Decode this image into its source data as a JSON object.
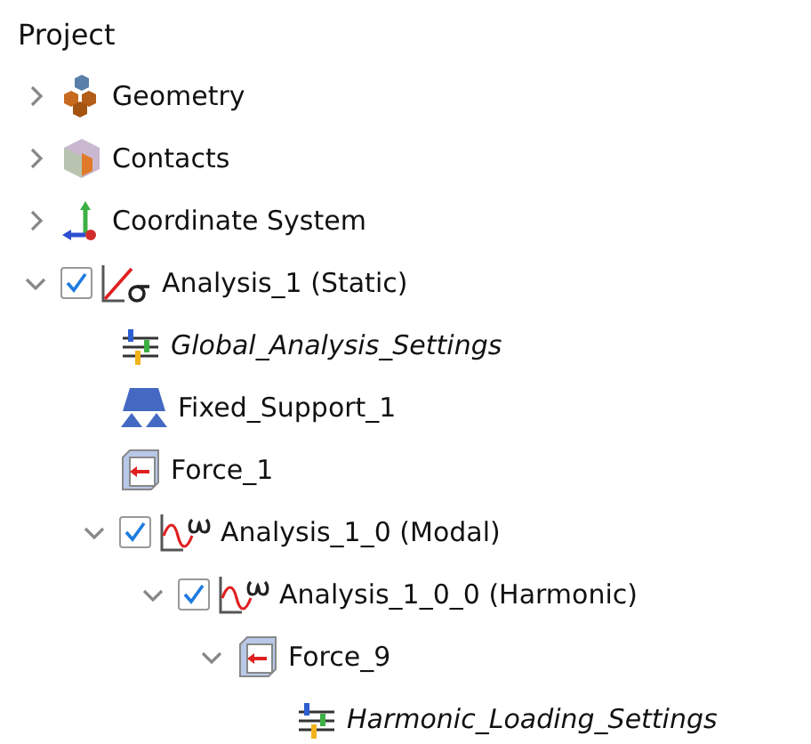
{
  "panel": {
    "title": "Project"
  },
  "tree": [
    {
      "label": "Geometry",
      "kind": "geometry",
      "expanded": false
    },
    {
      "label": "Contacts",
      "kind": "contact",
      "expanded": false
    },
    {
      "label": "Coordinate System",
      "kind": "axes",
      "expanded": false
    },
    {
      "label": "Analysis_1 (Static)",
      "kind": "static",
      "expanded": true,
      "checked": true,
      "children": [
        {
          "label": "Global_Analysis_Settings",
          "kind": "settings"
        },
        {
          "label": "Fixed_Support_1",
          "kind": "support"
        },
        {
          "label": "Force_1",
          "kind": "force"
        },
        {
          "label": "Analysis_1_0 (Modal)",
          "kind": "wave",
          "expanded": true,
          "checked": true,
          "children": [
            {
              "label": "Analysis_1_0_0 (Harmonic)",
              "kind": "wave",
              "expanded": true,
              "checked": true,
              "children": [
                {
                  "label": "Force_9",
                  "kind": "force",
                  "expanded": true,
                  "children": [
                    {
                      "label": "Harmonic_Loading_Settings",
                      "kind": "settings"
                    }
                  ]
                }
              ]
            }
          ]
        }
      ]
    }
  ]
}
